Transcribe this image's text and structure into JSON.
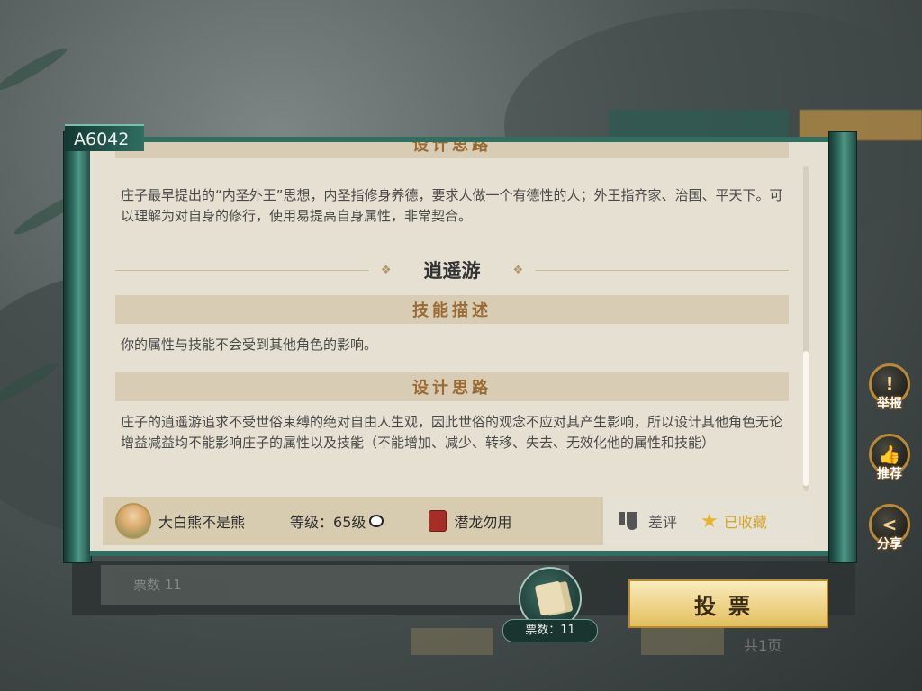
{
  "background": {
    "title_text": "",
    "author_text": "",
    "description_text": "",
    "tab1_label": "",
    "tab2_label": ""
  },
  "card": {
    "code": "A6042",
    "section1": {
      "header": "设计思路",
      "text": "庄子最早提出的“内圣外王”思想，内圣指修身养德，要求人做一个有德性的人；外王指齐家、治国、平天下。可以理解为对自身的修行，使用易提高自身属性，非常契合。"
    },
    "section2": {
      "title": "逍遥游",
      "desc_header": "技能描述",
      "desc_text": "你的属性与技能不会受到其他角色的影响。",
      "design_header": "设计思路",
      "design_text": "庄子的逍遥游追求不受世俗束缚的绝对自由人生观，因此世俗的观念不应对其产生影响，所以设计其他角色无论增益减益均不能影响庄子的属性以及技能（不能增加、减少、转移、失去、无效化他的属性和技能）"
    },
    "footer": {
      "author": "大白熊不是熊",
      "level": "等级：65级",
      "badge_title": "潜龙勿用",
      "dislike_label": "差评",
      "favorite_label": "已收藏"
    }
  },
  "side_buttons": {
    "report_label": "举报",
    "recommend_label": "推荐",
    "share_label": "分享"
  },
  "bottom": {
    "votes_label": "票数 11",
    "ticket_count_label": "票数：11",
    "vote_button_label": "投票",
    "prev_page_label": "",
    "next_page_label": "",
    "total_pages_label": "共1页"
  },
  "colors": {
    "accent_teal": "#2f6e61",
    "header_text": "#9a6b33",
    "gold": "#e3bf5f",
    "favorite": "#d4a52a"
  },
  "icons": [
    "warning-icon",
    "thumbs-up-icon",
    "share-icon",
    "thumbs-down-icon",
    "star-icon",
    "ticket-icon",
    "panda-icon",
    "badge-icon",
    "avatar"
  ]
}
